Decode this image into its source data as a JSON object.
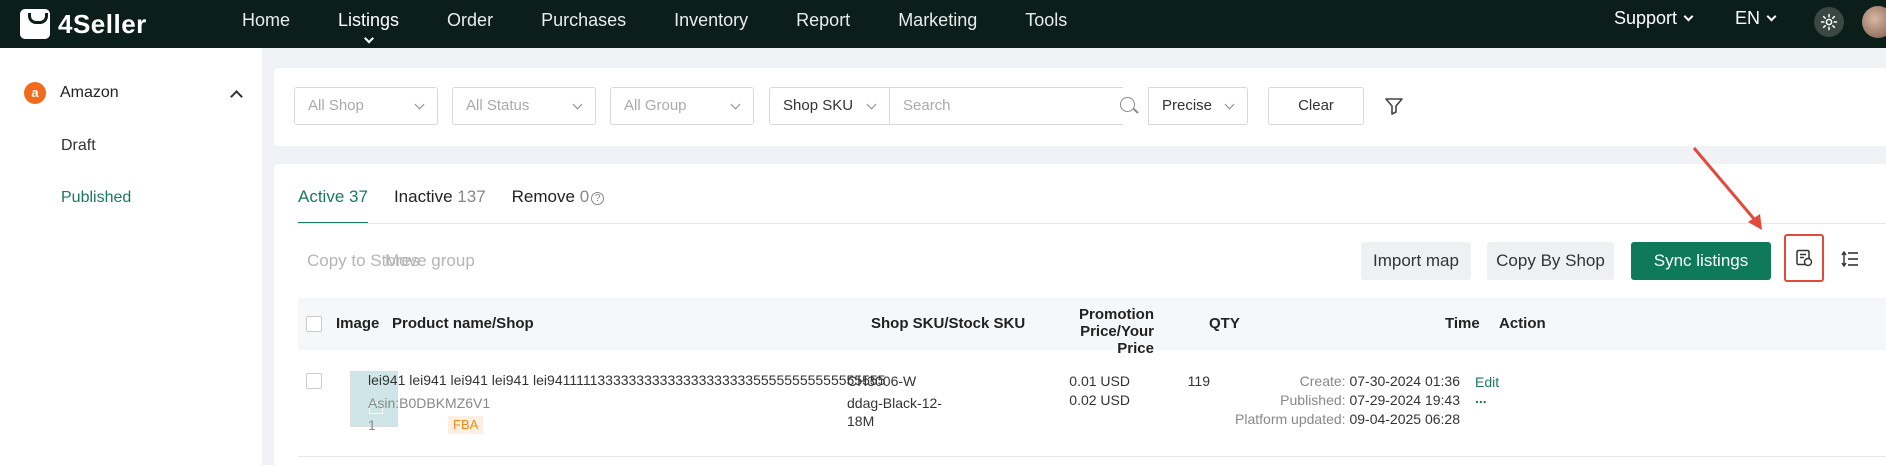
{
  "app": {
    "logo": "4Seller"
  },
  "nav": {
    "items": [
      "Home",
      "Listings",
      "Order",
      "Purchases",
      "Inventory",
      "Report",
      "Marketing",
      "Tools"
    ],
    "active": "Listings",
    "support": "Support",
    "language": "EN"
  },
  "sidebar": {
    "platform": "Amazon",
    "platform_icon": "a",
    "items": [
      {
        "label": "Draft",
        "active": false
      },
      {
        "label": "Published",
        "active": true
      }
    ]
  },
  "filters": {
    "shop": "All Shop",
    "status": "All Status",
    "group": "All Group",
    "search_field": "Shop SKU",
    "search_placeholder": "Search",
    "match_mode": "Precise",
    "clear_label": "Clear"
  },
  "tabs": [
    {
      "label": "Active",
      "count": "37",
      "active": true
    },
    {
      "label": "Inactive",
      "count": "137",
      "active": false
    },
    {
      "label": "Remove",
      "count": "0",
      "active": false,
      "help": "?"
    }
  ],
  "toolbar": {
    "copy_to_stores": "Copy to Stores",
    "move_group": "Move group",
    "import_map": "Import map",
    "copy_by_shop": "Copy By Shop",
    "sync_listings": "Sync listings"
  },
  "table": {
    "headers": {
      "image": "Image",
      "product": "Product name/Shop",
      "sku": "Shop SKU/Stock SKU",
      "price_line1": "Promotion Price/Your",
      "price_line2": "Price",
      "qty": "QTY",
      "time": "Time",
      "action": "Action"
    },
    "rows": [
      {
        "product_name": "lei941 lei941 lei941 lei941 lei94111113333333333333333333355555555555555555",
        "asin": "Asin:B0DBKMZ6V1",
        "shop_index": "1",
        "fulfillment": "FBA",
        "shop_sku": "CH3006-W",
        "stock_sku_line1": "ddag-Black-12-",
        "stock_sku_line2": "18M",
        "promo_price": "0.01 USD",
        "your_price": "0.02 USD",
        "qty": "119",
        "create_label": "Create:",
        "create_time": "07-30-2024 01:36",
        "published_label": "Published:",
        "published_time": "07-29-2024 19:43",
        "platform_label": "Platform updated:",
        "platform_time": "09-04-2025 06:28",
        "action_edit": "Edit",
        "action_more": "..."
      }
    ]
  },
  "colors": {
    "brand": "#0e7a5a",
    "topbar": "#0c1e1a",
    "highlight": "#e24a3b",
    "fba": "#f08a1c"
  }
}
